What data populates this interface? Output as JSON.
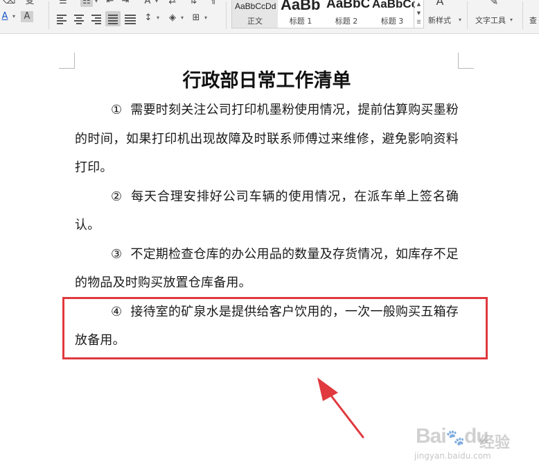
{
  "ribbon": {
    "styles": [
      {
        "sample": "AaBbCcDd",
        "name": "正文",
        "active": true
      },
      {
        "sample": "AaBb",
        "name": "标题 1"
      },
      {
        "sample": "AaBbC",
        "name": "标题 2"
      },
      {
        "sample": "AaBbCc",
        "name": "标题 3"
      }
    ],
    "new_style_label": "新样式",
    "text_tools_label": "文字工具",
    "find_label": "查"
  },
  "document": {
    "title": "行政部日常工作清单",
    "paragraphs": [
      {
        "num": "①",
        "text": "需要时刻关注公司打印机墨粉使用情况，提前估算购买墨粉的时间，如果打印机出现故障及时联系师傅过来维修，避免影响资料打印。"
      },
      {
        "num": "②",
        "text": "每天合理安排好公司车辆的使用情况，在派车单上签名确认。"
      },
      {
        "num": "③",
        "text": "不定期检查仓库的办公用品的数量及存货情况，如库存不足的物品及时购买放置仓库备用。"
      },
      {
        "num": "④",
        "text": "接待室的矿泉水是提供给客户饮用的，一次一般购买五箱存放备用。"
      }
    ]
  },
  "watermark": {
    "brand": "Bai",
    "brand2": "du",
    "chinese": "经验",
    "url": "jingyan.baidu.com"
  },
  "colors": {
    "highlight_border": "#e0393e",
    "arrow": "#e0393e"
  }
}
